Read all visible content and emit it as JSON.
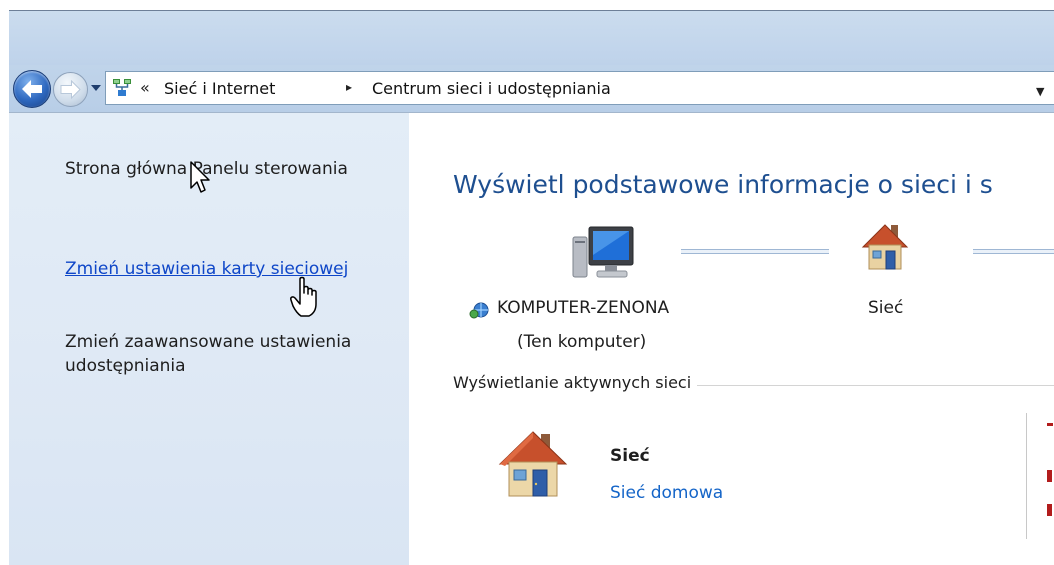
{
  "window": {
    "breadcrumb": {
      "overflow": "«",
      "items": [
        "Sieć i Internet",
        "Centrum sieci i udostępniania"
      ],
      "separator": "▸"
    }
  },
  "left_nav": {
    "items": [
      {
        "label": "Strona główna Panelu sterowania",
        "is_link": false
      },
      {
        "label": "Zmień ustawienia karty sieciowej",
        "is_link": true
      },
      {
        "label": "Zmień zaawansowane ustawienia udostępniania",
        "is_link": false
      }
    ]
  },
  "main": {
    "title": "Wyświetl podstawowe informacje o sieci i s",
    "network_map": {
      "computer_name": "KOMPUTER-ZENONA",
      "computer_subtitle": "(Ten komputer)",
      "network_label": "Sieć"
    },
    "active_networks": {
      "section_label": "Wyświetlanie aktywnych sieci",
      "network_name": "Sieć",
      "network_type": "Sieć domowa"
    }
  },
  "colors": {
    "link": "#0e46c8",
    "title": "#1e4f90",
    "network_type_link": "#1565c8",
    "left_pane_bg": "#dfe9f5"
  },
  "icons": [
    "back-arrow-icon",
    "forward-arrow-icon",
    "history-dropdown-icon",
    "network-center-icon",
    "computer-icon",
    "home-network-icon",
    "network-badge-icon",
    "arrow-cursor-icon",
    "hand-cursor-icon"
  ]
}
